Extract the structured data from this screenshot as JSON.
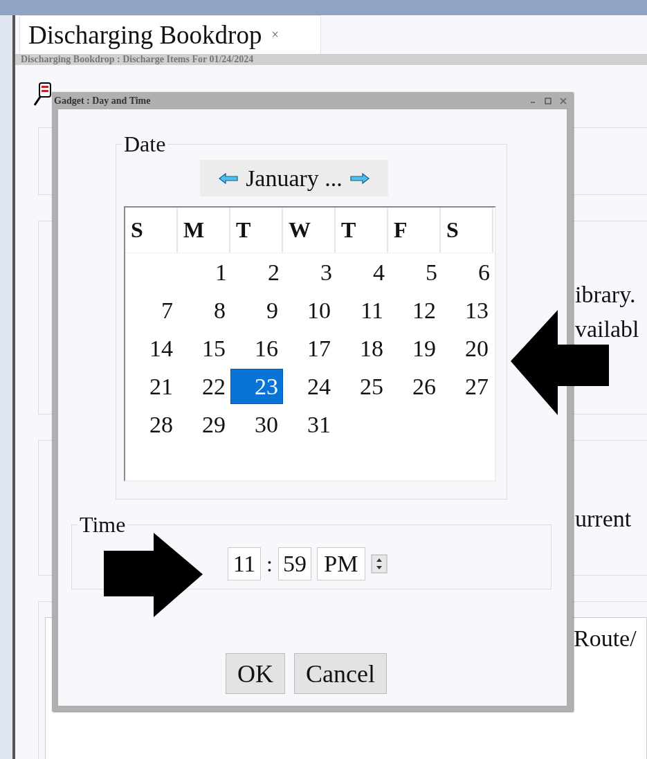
{
  "tab": {
    "title": "Discharging Bookdrop",
    "close": "×"
  },
  "subtitle": "Discharging Bookdrop : Discharge Items For 01/24/2024",
  "background_texts": [
    "ibrary.",
    "vailabl",
    "urrent",
    "Route/"
  ],
  "dialog": {
    "title": "Gadget : Day and Time",
    "date": {
      "legend": "Date",
      "month": "January ...",
      "weekdays": [
        "S",
        "M",
        "T",
        "W",
        "T",
        "F",
        "S"
      ],
      "weeks": [
        {
          "kind": "first",
          "days": [
            {
              "label": "1",
              "selected": false
            },
            {
              "label": "2",
              "selected": false
            },
            {
              "label": "3",
              "selected": false
            },
            {
              "label": "4",
              "selected": false
            },
            {
              "label": "5",
              "selected": false
            },
            {
              "label": "6",
              "selected": false
            }
          ]
        },
        {
          "kind": "regular",
          "days": [
            {
              "label": "7",
              "selected": false
            },
            {
              "label": "8",
              "selected": false
            },
            {
              "label": "9",
              "selected": false
            },
            {
              "label": "10",
              "selected": false
            },
            {
              "label": "11",
              "selected": false
            },
            {
              "label": "12",
              "selected": false
            },
            {
              "label": "13",
              "selected": false
            }
          ]
        },
        {
          "kind": "regular",
          "days": [
            {
              "label": "14",
              "selected": false
            },
            {
              "label": "15",
              "selected": false
            },
            {
              "label": "16",
              "selected": false
            },
            {
              "label": "17",
              "selected": false
            },
            {
              "label": "18",
              "selected": false
            },
            {
              "label": "19",
              "selected": false
            },
            {
              "label": "20",
              "selected": false
            }
          ]
        },
        {
          "kind": "regular",
          "days": [
            {
              "label": "21",
              "selected": false
            },
            {
              "label": "22",
              "selected": false
            },
            {
              "label": "23",
              "selected": true
            },
            {
              "label": "24",
              "selected": false
            },
            {
              "label": "25",
              "selected": false
            },
            {
              "label": "26",
              "selected": false
            },
            {
              "label": "27",
              "selected": false
            }
          ]
        },
        {
          "kind": "regular",
          "days": [
            {
              "label": "28",
              "selected": false
            },
            {
              "label": "29",
              "selected": false
            },
            {
              "label": "30",
              "selected": false
            },
            {
              "label": "31",
              "selected": false
            }
          ]
        }
      ]
    },
    "time": {
      "legend": "Time",
      "hour": "11",
      "separator": ":",
      "minute": "59",
      "period": "PM"
    },
    "buttons": [
      "OK",
      "Cancel"
    ]
  }
}
